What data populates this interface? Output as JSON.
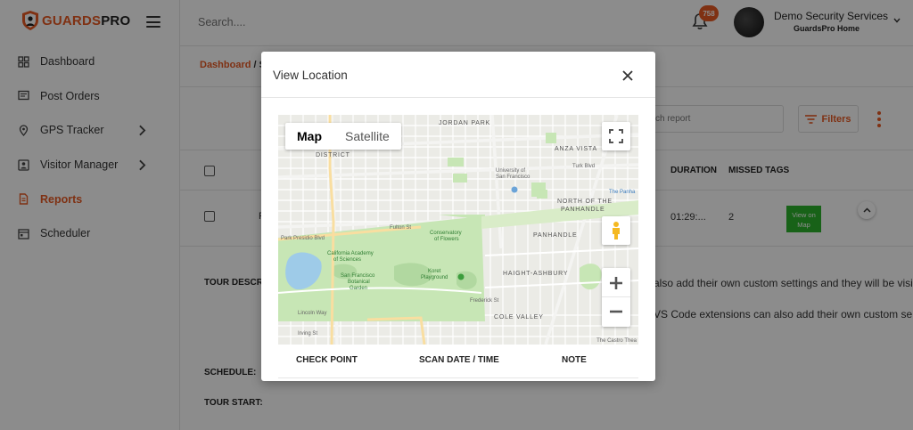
{
  "brand": {
    "logo_part1": "GUARDS",
    "logo_part2": "PRO"
  },
  "sidebar": {
    "items": [
      {
        "label": "Dashboard",
        "icon": "dashboard-icon",
        "active": false,
        "chevron": false
      },
      {
        "label": "Post Orders",
        "icon": "post-orders-icon",
        "active": false,
        "chevron": false
      },
      {
        "label": "GPS Tracker",
        "icon": "location-pin-icon",
        "active": false,
        "chevron": true
      },
      {
        "label": "Visitor Manager",
        "icon": "visitor-icon",
        "active": false,
        "chevron": true
      },
      {
        "label": "Reports",
        "icon": "reports-icon",
        "active": true,
        "chevron": false
      },
      {
        "label": "Scheduler",
        "icon": "calendar-icon",
        "active": false,
        "chevron": false
      }
    ]
  },
  "topbar": {
    "search_placeholder": "Search....",
    "notification_count": "758",
    "user_name": "Demo Security Services",
    "user_sub": "GuardsPro Home"
  },
  "breadcrumb": {
    "part1": "Dashboard",
    "separator": " / ",
    "part2": "S"
  },
  "toolbar": {
    "search_report_placeholder": "ch report",
    "filters_label": "Filters"
  },
  "table": {
    "headers": {
      "duration": "DURATION",
      "missed_tags": "MISSED TAGS"
    },
    "row": {
      "col_fragment": "F",
      "duration": "01:29:...",
      "missed_tags": "2",
      "action_label": "View on Map"
    }
  },
  "details": {
    "tour_description_label": "TOUR DESCRI",
    "desc_line1": "also add their own custom settings and they will be visi",
    "desc_line2": "VS Code extensions can also add their own custom se",
    "schedule_label": "SCHEDULE:",
    "tour_start_label": "TOUR START:"
  },
  "modal": {
    "title": "View Location",
    "map": {
      "tab_map": "Map",
      "tab_satellite": "Satellite",
      "labels": {
        "jordan_park": "JORDAN PARK",
        "anza_vista": "ANZA VISTA",
        "north_panhandle_1": "NORTH OF THE",
        "north_panhandle_2": "PANHANDLE",
        "panhandle": "PANHANDLE",
        "haight_ashbury": "HAIGHT-ASHBURY",
        "cole_valley": "COLE VALLEY",
        "district": "DISTRICT",
        "univ_1": "University of",
        "univ_2": "San Francisco",
        "the_panhandle": "The Panha",
        "conservatory_1": "Conservatory",
        "conservatory_2": "of Flowers",
        "academy_1": "California Academy",
        "academy_2": "of Sciences",
        "garden_1": "San Francisco",
        "garden_2": "Botanical",
        "garden_3": "Garden",
        "koret_1": "Koret",
        "koret_2": "Playground",
        "park_presidio": "Park Presidio Blvd",
        "fulton": "Fulton St",
        "turk": "Turk Blvd",
        "lincoln": "Lincoln Way",
        "irving": "Irving St",
        "frederick": "Frederick St",
        "castro": "The Castro Thea"
      }
    },
    "columns": {
      "check_point": "CHECK POINT",
      "scan_date_time": "SCAN DATE / TIME",
      "note": "NOTE"
    }
  },
  "colors": {
    "brand": "#e85a24",
    "view_button": "#2db32d",
    "park": "#c7e6b5",
    "water": "#9ecbe8"
  }
}
